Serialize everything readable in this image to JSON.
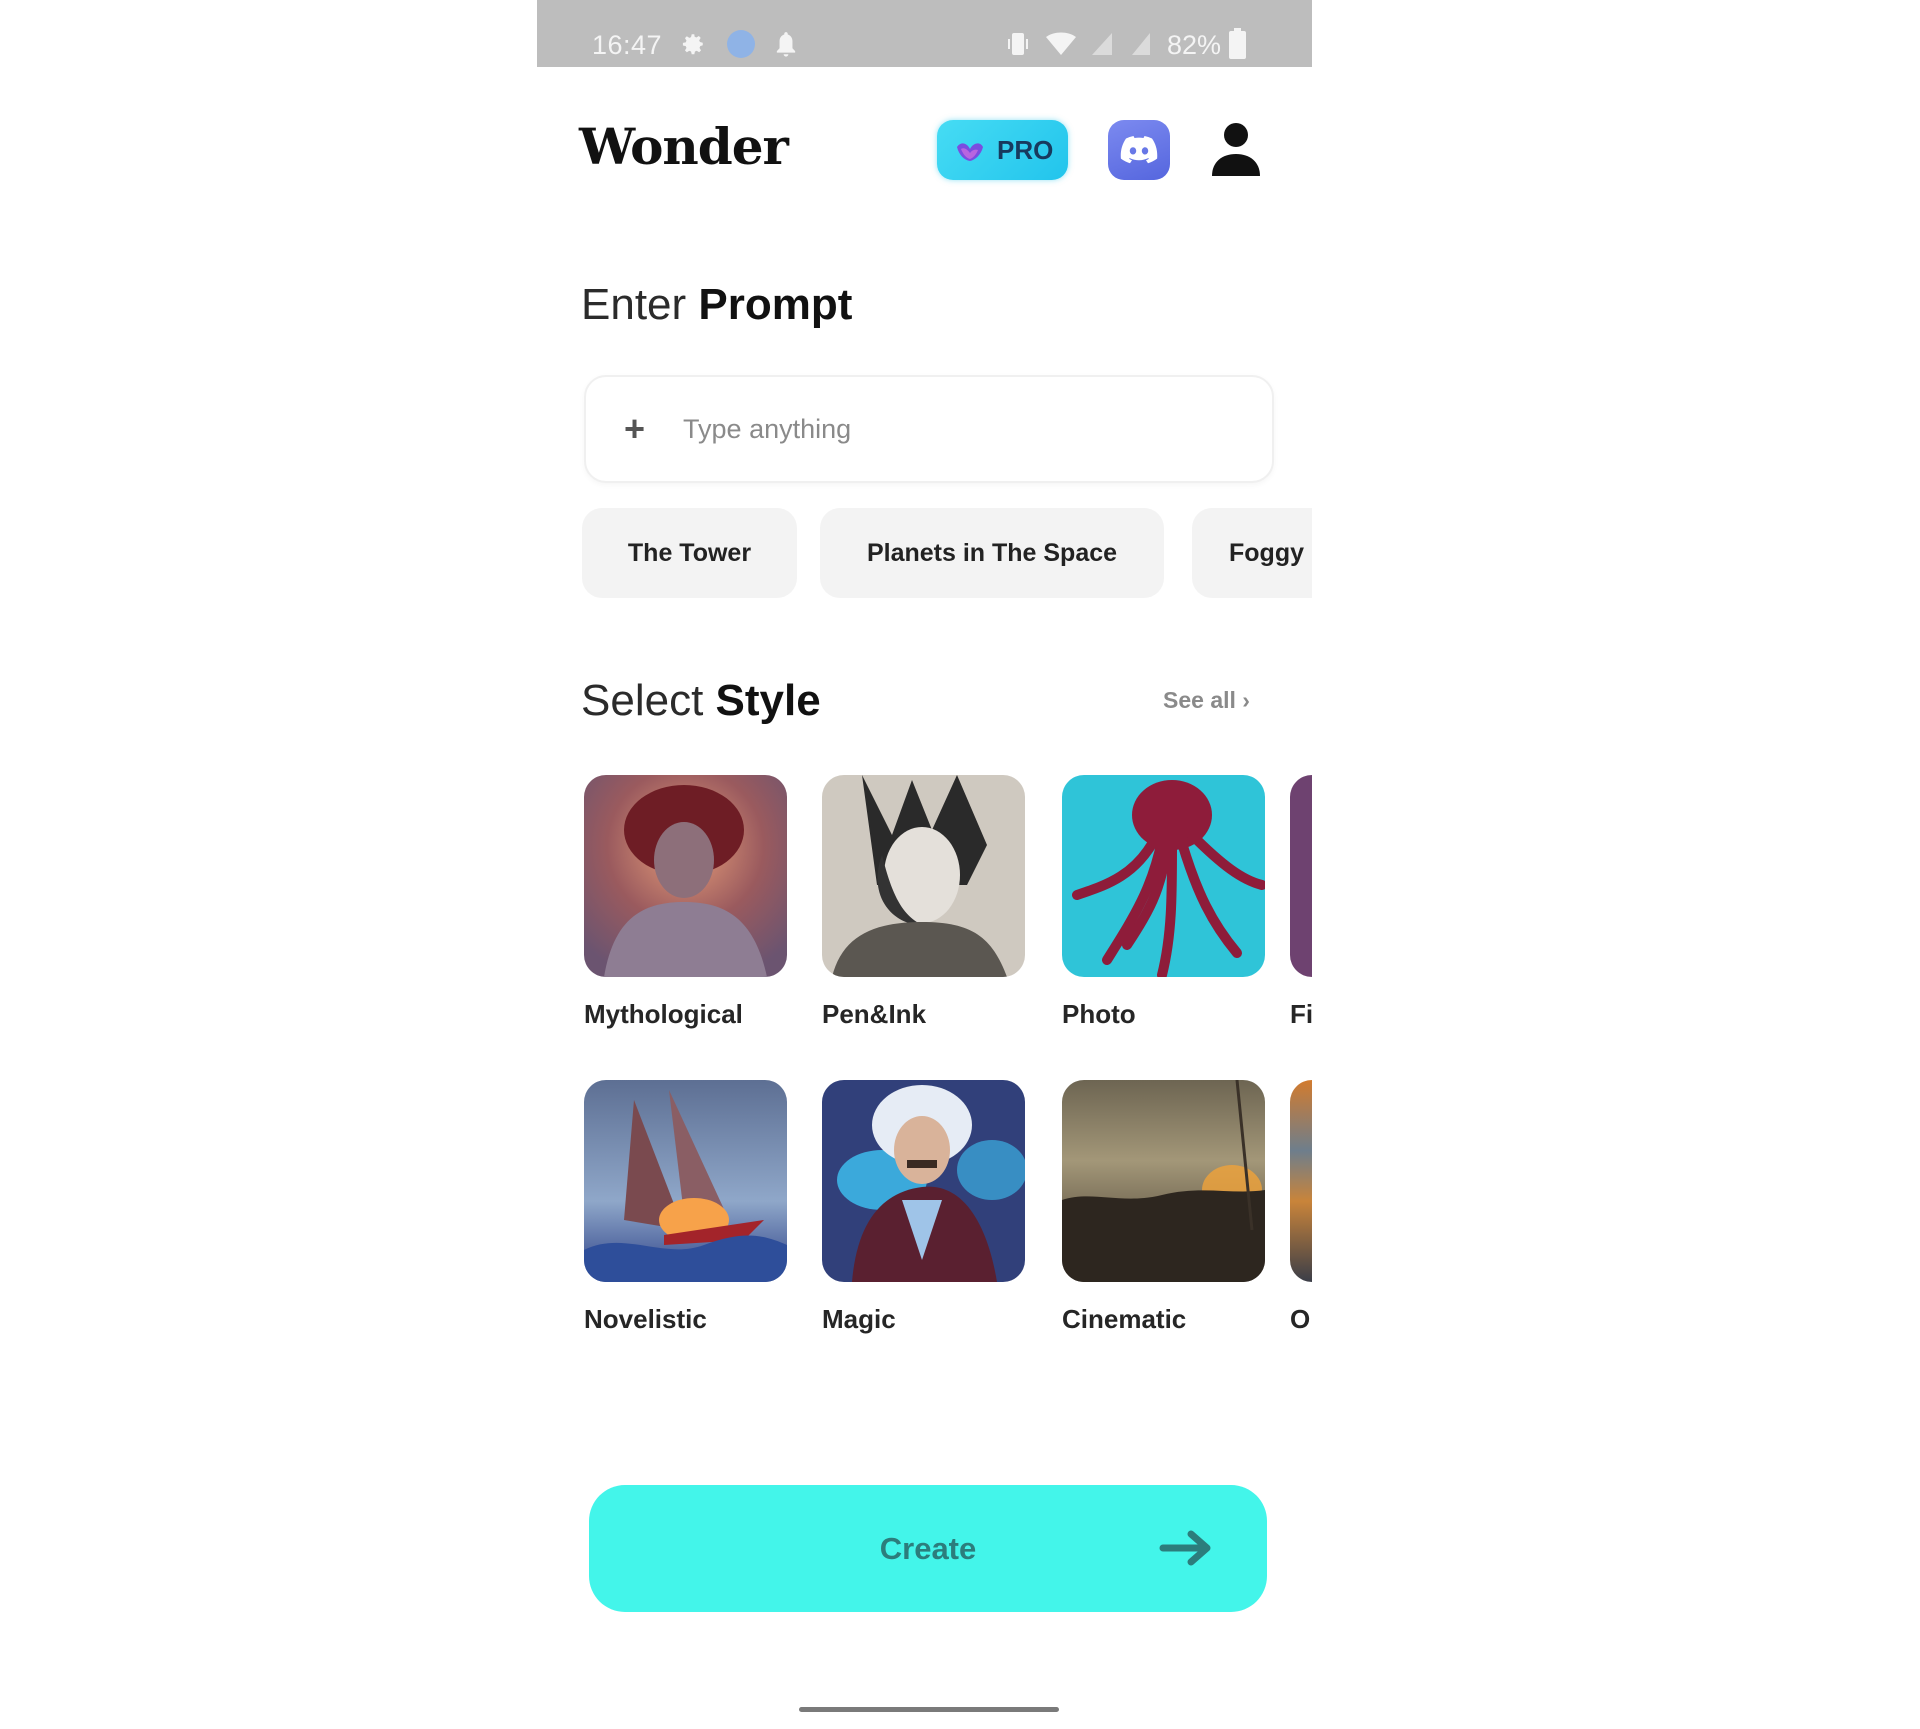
{
  "status_bar": {
    "time": "16:47",
    "battery_percent": "82%",
    "icons": [
      "gear-icon",
      "notification-dot-icon",
      "bell-icon",
      "vibrate-icon",
      "wifi-icon",
      "signal-icon",
      "signal-icon",
      "battery-icon"
    ]
  },
  "header": {
    "logo": "Wonder",
    "pro_label": "PRO",
    "discord_icon": "discord-icon",
    "account_icon": "person-icon"
  },
  "prompt": {
    "title_light": "Enter",
    "title_bold": "Prompt",
    "input_value": "",
    "placeholder": "Type anything",
    "add_icon": "plus-icon",
    "suggestions": [
      "The Tower",
      "Planets in The Space",
      "Foggy"
    ]
  },
  "style": {
    "title_light": "Select",
    "title_bold": "Style",
    "see_all": "See all",
    "see_all_icon": "chevron-right-icon",
    "items": [
      {
        "label": "Mythological"
      },
      {
        "label": "Pen&Ink"
      },
      {
        "label": "Photo"
      },
      {
        "label": "Fi"
      },
      {
        "label": "Novelistic"
      },
      {
        "label": "Magic"
      },
      {
        "label": "Cinematic"
      },
      {
        "label": "O"
      }
    ]
  },
  "actions": {
    "create_label": "Create",
    "create_icon": "arrow-right-icon"
  },
  "colors": {
    "accent": "#43f5ea",
    "pro_gradient_start": "#46dcf4",
    "discord": "#5865f2",
    "status_bar": "#bdbdbd"
  }
}
